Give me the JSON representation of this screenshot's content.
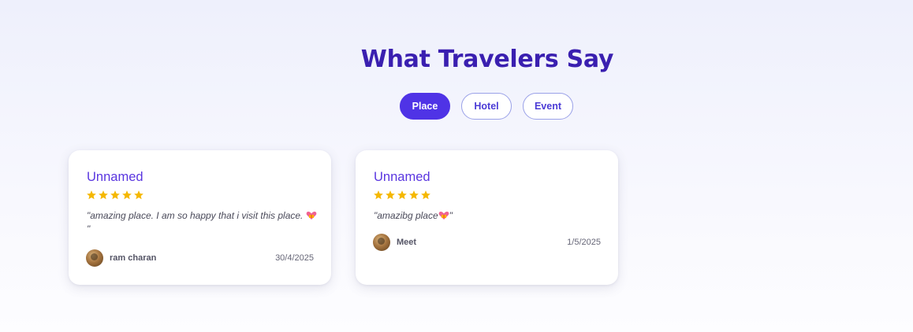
{
  "section": {
    "title": "What Travelers Say",
    "tabs": [
      {
        "label": "Place",
        "active": true
      },
      {
        "label": "Hotel",
        "active": false
      },
      {
        "label": "Event",
        "active": false
      }
    ]
  },
  "reviews": [
    {
      "name": "Unnamed",
      "rating": 5,
      "quote_text": "\"amazing place. I am so happy that i visit this place. ",
      "quote_end": "\"",
      "quote_emoji": "heart-gift-emoji",
      "author": "ram charan",
      "date": "30/4/2025"
    },
    {
      "name": "Unnamed",
      "rating": 5,
      "quote_text": "\"amazibg place",
      "quote_end": "\"",
      "quote_emoji": "heart-gift-emoji",
      "author": "Meet",
      "date": "1/5/2025"
    }
  ],
  "colors": {
    "accent": "#4f33e6",
    "title": "#3a1fb0",
    "star": "#f5b800"
  }
}
